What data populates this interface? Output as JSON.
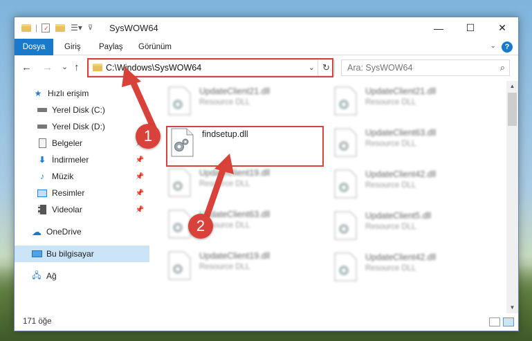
{
  "window": {
    "title": "SysWOW64",
    "minimize_glyph": "—",
    "maximize_glyph": "☐",
    "close_glyph": "✕"
  },
  "ribbon": {
    "tabs": [
      "Dosya",
      "Giriş",
      "Paylaş",
      "Görünüm"
    ],
    "help_label": "?"
  },
  "navbar": {
    "back_glyph": "←",
    "forward_glyph": "→",
    "recent_glyph": "⌄",
    "up_glyph": "↑",
    "address": "C:\\Windows\\SysWOW64",
    "refresh_glyph": "↻",
    "search_placeholder": "Ara: SysWOW64"
  },
  "sidebar": {
    "items": [
      {
        "label": "Hızlı erişim",
        "icon": "star-icon"
      },
      {
        "label": "Yerel Disk (C:)",
        "icon": "drive-icon"
      },
      {
        "label": "Yerel Disk (D:)",
        "icon": "drive-icon"
      },
      {
        "label": "Belgeler",
        "icon": "documents-icon"
      },
      {
        "label": "İndirmeler",
        "icon": "download-icon"
      },
      {
        "label": "Müzik",
        "icon": "music-icon"
      },
      {
        "label": "Resimler",
        "icon": "pictures-icon"
      },
      {
        "label": "Videolar",
        "icon": "videos-icon"
      },
      {
        "label": "OneDrive",
        "icon": "cloud-icon"
      },
      {
        "label": "Bu bilgisayar",
        "icon": "computer-icon"
      },
      {
        "label": "Ağ",
        "icon": "network-icon"
      }
    ]
  },
  "files": {
    "highlighted": {
      "name": "findsetup.dll",
      "type": ""
    },
    "blurred": [
      {
        "name": "UpdateClient21.dll",
        "type": "Resource DLL"
      },
      {
        "name": "UpdateClient21.dll",
        "type": "Resource DLL"
      },
      {
        "name": "UpdateClient63.dll",
        "type": "Resource DLL"
      },
      {
        "name": "UpdateClient19.dll",
        "type": "Resource DLL"
      },
      {
        "name": "UpdateClient42.dll",
        "type": "Resource DLL"
      },
      {
        "name": "UpdateClient63.dll",
        "type": "Resource DLL"
      },
      {
        "name": "UpdateClient5.dll",
        "type": "Resource DLL"
      },
      {
        "name": "UpdateClient19.dll",
        "type": "Resource DLL"
      },
      {
        "name": "UpdateClient42.dll",
        "type": "Resource DLL"
      }
    ]
  },
  "status": {
    "item_count": "171 öğe"
  },
  "markers": {
    "step1": "1",
    "step2": "2"
  },
  "colors": {
    "accent": "#1979ca",
    "highlight": "#d9423a",
    "selected": "#cce4f7"
  }
}
